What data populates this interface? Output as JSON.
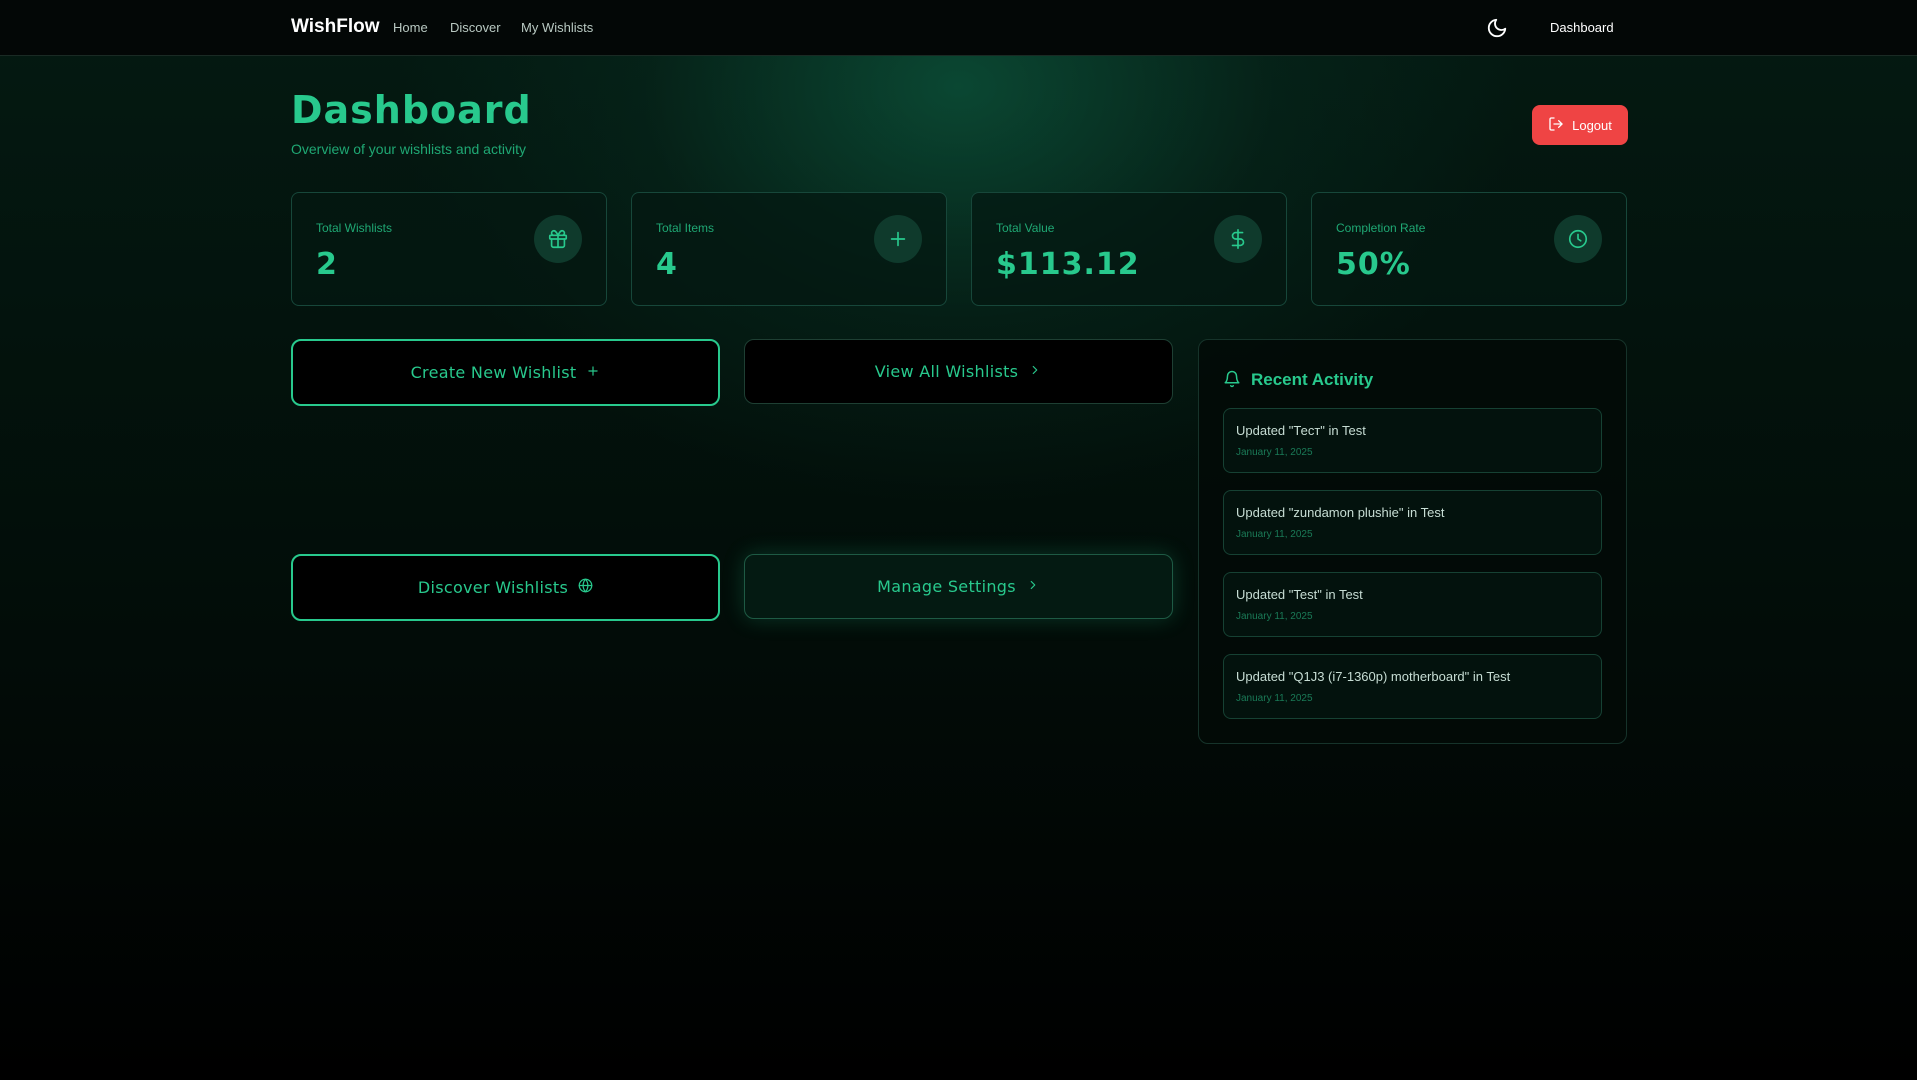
{
  "nav": {
    "brand": "WishFlow",
    "links": [
      "Home",
      "Discover",
      "My Wishlists"
    ],
    "right_link": "Dashboard"
  },
  "header": {
    "title": "Dashboard",
    "subtitle": "Overview of your wishlists and activity",
    "logout_label": "Logout"
  },
  "stats": [
    {
      "label": "Total Wishlists",
      "value": "2",
      "icon": "gift-icon"
    },
    {
      "label": "Total Items",
      "value": "4",
      "icon": "plus-icon"
    },
    {
      "label": "Total Value",
      "value": "$113.12",
      "icon": "dollar-icon"
    },
    {
      "label": "Completion Rate",
      "value": "50%",
      "icon": "clock-icon"
    }
  ],
  "actions": {
    "create": "Create New Wishlist",
    "view_all": "View All Wishlists",
    "discover": "Discover Wishlists",
    "settings": "Manage Settings"
  },
  "activity": {
    "title": "Recent Activity",
    "items": [
      {
        "text": "Updated \"Тест\" in Test",
        "date": "January 11, 2025"
      },
      {
        "text": "Updated \"zundamon plushie\" in Test",
        "date": "January 11, 2025"
      },
      {
        "text": "Updated \"Test\" in Test",
        "date": "January 11, 2025"
      },
      {
        "text": "Updated \"Q1J3 (i7-1360p) motherboard\" in Test",
        "date": "January 11, 2025"
      }
    ]
  },
  "colors": {
    "accent": "#28c98d",
    "logout": "#ef4444",
    "background": "#020c08"
  }
}
